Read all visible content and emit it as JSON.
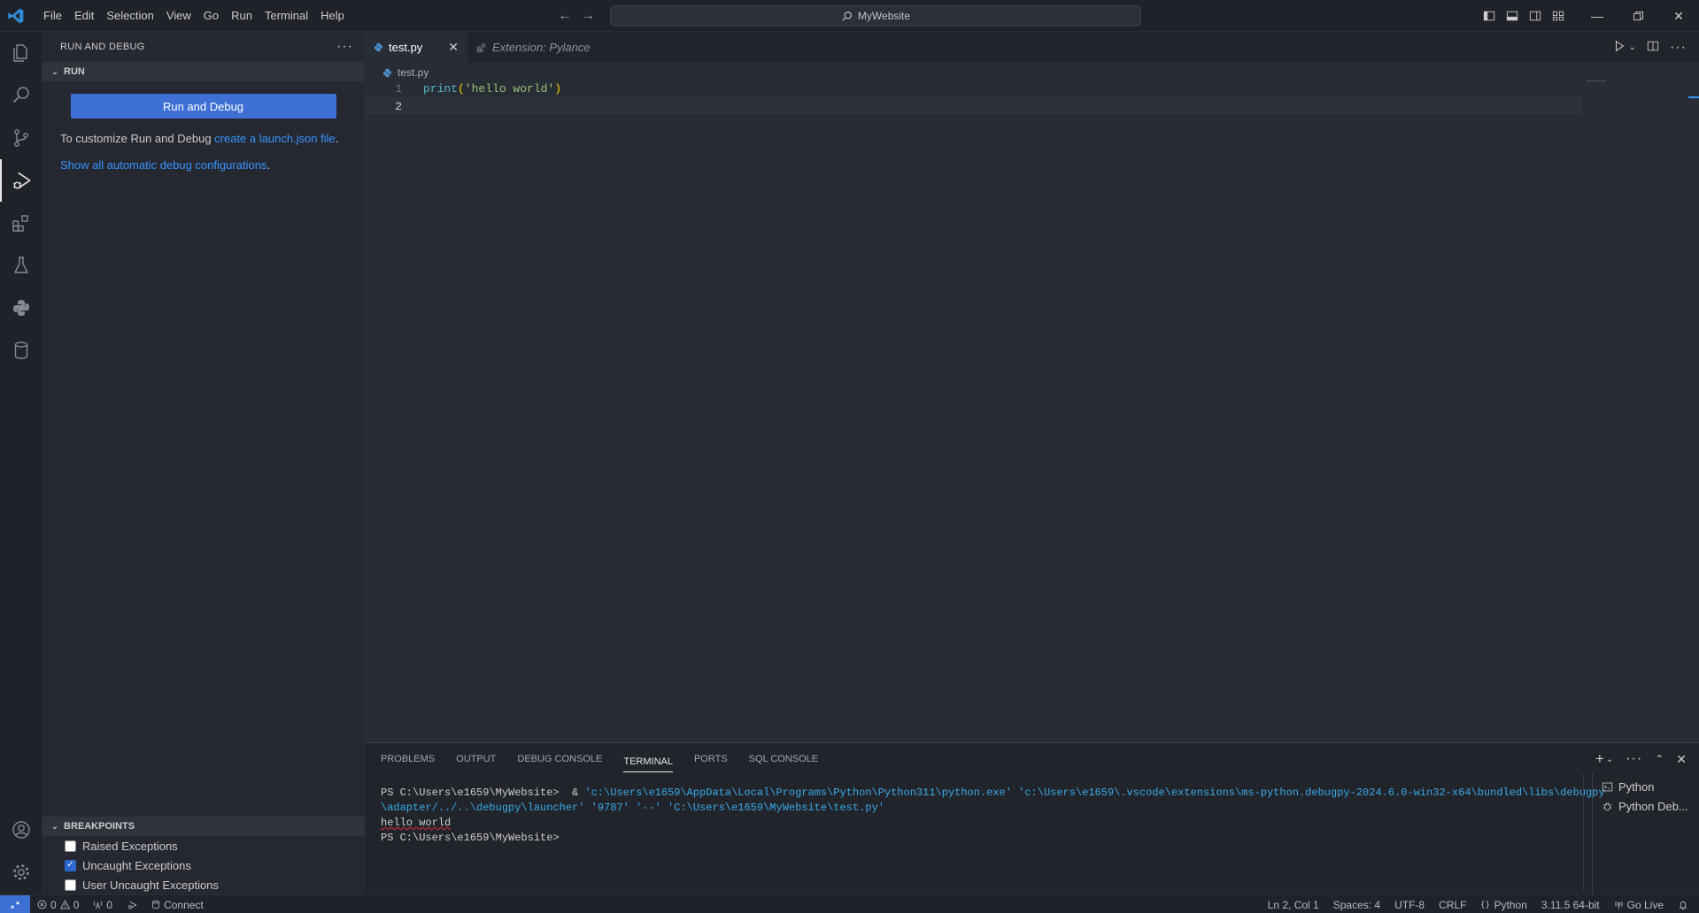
{
  "titlebar": {
    "menu": [
      "File",
      "Edit",
      "Selection",
      "View",
      "Go",
      "Run",
      "Terminal",
      "Help"
    ],
    "search_text": "MyWebsite"
  },
  "sidebar": {
    "title": "RUN AND DEBUG",
    "run_section": "RUN",
    "run_button": "Run and Debug",
    "customize_prefix": "To customize Run and Debug ",
    "customize_link": "create a launch.json file",
    "customize_suffix": ".",
    "show_all_link": "Show all automatic debug configurations",
    "show_all_suffix": ".",
    "breakpoints_section": "BREAKPOINTS",
    "breakpoints": [
      {
        "label": "Raised Exceptions",
        "checked": false
      },
      {
        "label": "Uncaught Exceptions",
        "checked": true
      },
      {
        "label": "User Uncaught Exceptions",
        "checked": false
      }
    ]
  },
  "editor": {
    "tabs": [
      {
        "label": "test.py",
        "active": true
      },
      {
        "label": "Extension: Pylance",
        "active": false
      }
    ],
    "breadcrumb": "test.py",
    "lines": [
      {
        "num": "1",
        "fn": "print",
        "open": "(",
        "str": "'hello world'",
        "close": ")"
      },
      {
        "num": "2"
      }
    ]
  },
  "panel": {
    "tabs": [
      "PROBLEMS",
      "OUTPUT",
      "DEBUG CONSOLE",
      "TERMINAL",
      "PORTS",
      "SQL CONSOLE"
    ],
    "active_tab": "TERMINAL",
    "terminal": {
      "prompt1": "PS C:\\Users\\e1659\\MyWebsite> ",
      "amp": " & ",
      "cmd_line1": "'c:\\Users\\e1659\\AppData\\Local\\Programs\\Python\\Python311\\python.exe' 'c:\\Users\\e1659\\.vscode\\extensions\\ms-python.debugpy-2024.6.0-win32-x64\\bundled\\libs\\debugpy",
      "cmd_line2": "\\adapter/../..\\debugpy\\launcher' '9787' '--' 'C:\\Users\\e1659\\MyWebsite\\test.py'",
      "output": "hello world",
      "prompt2": "PS C:\\Users\\e1659\\MyWebsite>"
    },
    "terminal_list": [
      "Python",
      "Python Deb..."
    ]
  },
  "statusbar": {
    "errors": "0",
    "warnings": "0",
    "ports": "0",
    "connect": "Connect",
    "position": "Ln 2, Col 1",
    "spaces": "Spaces: 4",
    "encoding": "UTF-8",
    "eol": "CRLF",
    "language": "Python",
    "interpreter": "3.11.5 64-bit",
    "golive": "Go Live"
  },
  "colors": {
    "accent": "#3d6fd4",
    "link": "#3794ff",
    "background": "#282c34",
    "sidebar": "#252830"
  }
}
